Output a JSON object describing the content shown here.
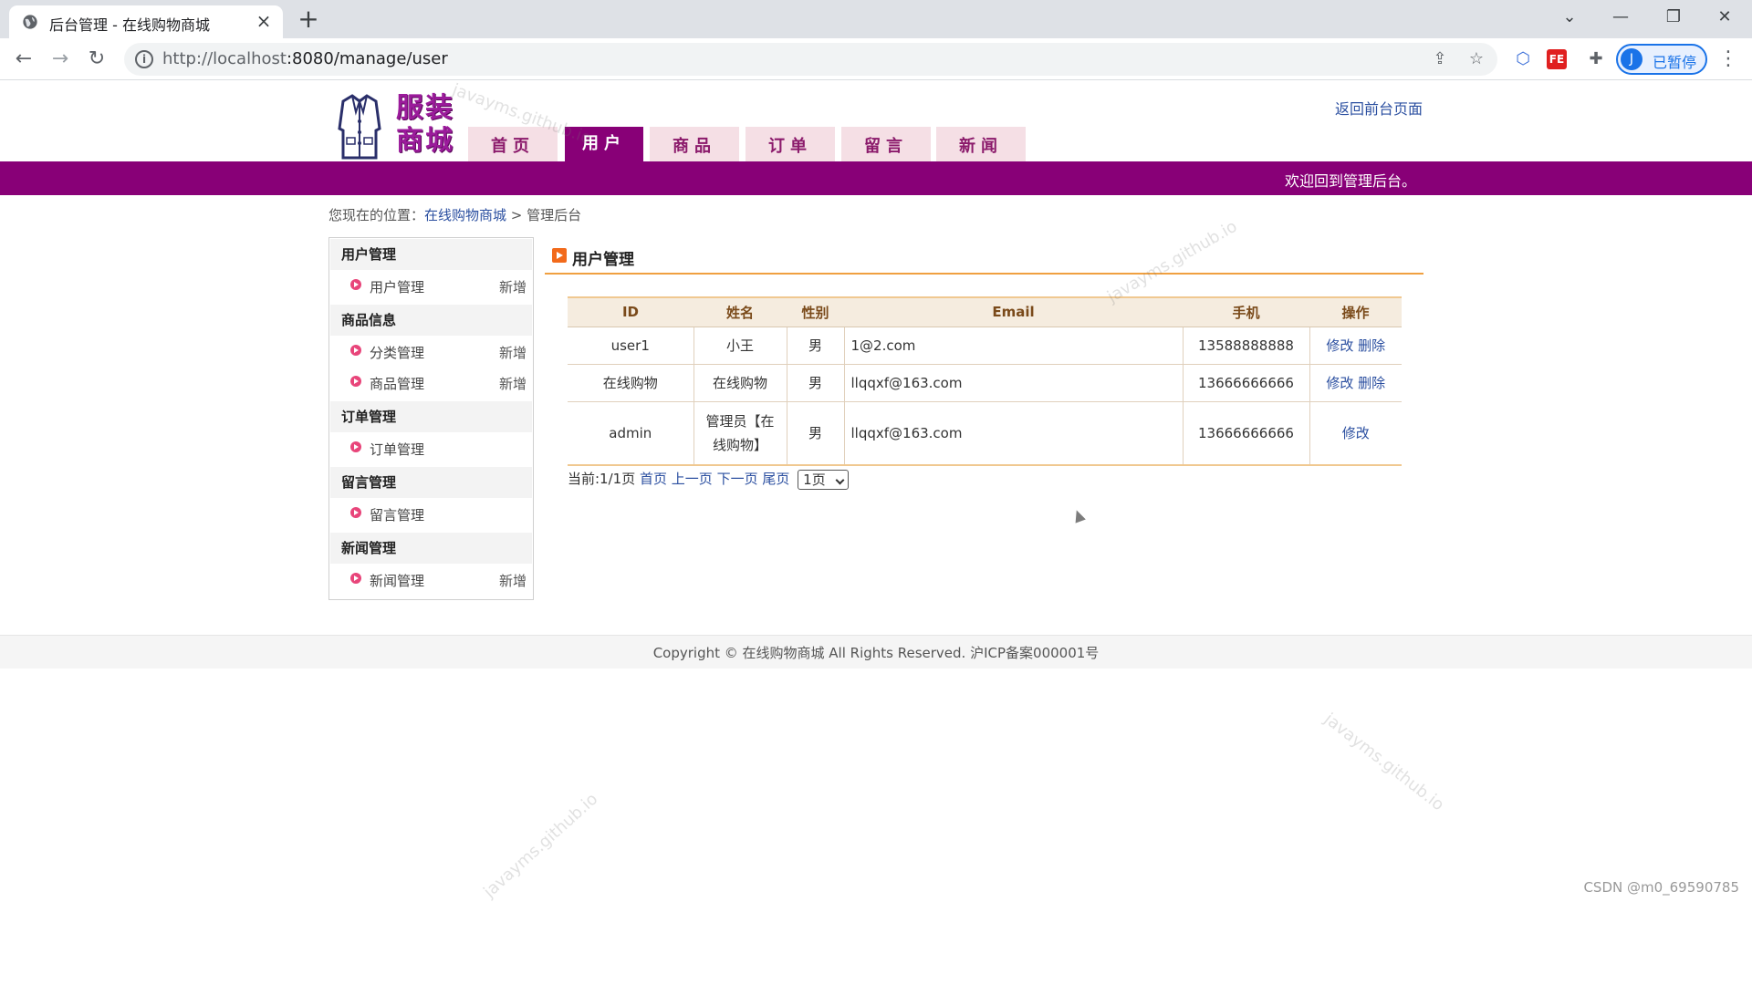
{
  "browser": {
    "tab_title": "后台管理 - 在线购物商城",
    "url_host": "http://localhost",
    "url_path": ":8080/manage/user",
    "profile_initial": "J",
    "profile_label": "已暂停"
  },
  "header": {
    "logo_text_line1": "服装",
    "logo_text_line2": "商城",
    "nav": [
      {
        "label": "首页"
      },
      {
        "label": "用户"
      },
      {
        "label": "商品"
      },
      {
        "label": "订单"
      },
      {
        "label": "留言"
      },
      {
        "label": "新闻"
      }
    ],
    "active_nav": "用户",
    "back_link": "返回前台页面",
    "welcome": "欢迎回到管理后台。"
  },
  "breadcrumb": {
    "prefix": "您现在的位置：",
    "home": "在线购物商城",
    "sep": " > ",
    "current": "管理后台"
  },
  "sidebar": {
    "groups": [
      {
        "title": "用户管理",
        "items": [
          {
            "label": "用户管理",
            "add": "新增"
          }
        ]
      },
      {
        "title": "商品信息",
        "items": [
          {
            "label": "分类管理",
            "add": "新增"
          },
          {
            "label": "商品管理",
            "add": "新增"
          }
        ]
      },
      {
        "title": "订单管理",
        "items": [
          {
            "label": "订单管理",
            "add": ""
          }
        ]
      },
      {
        "title": "留言管理",
        "items": [
          {
            "label": "留言管理",
            "add": ""
          }
        ]
      },
      {
        "title": "新闻管理",
        "items": [
          {
            "label": "新闻管理",
            "add": "新增"
          }
        ]
      }
    ]
  },
  "panel": {
    "title": "用户管理"
  },
  "table": {
    "headers": [
      "ID",
      "姓名",
      "性别",
      "Email",
      "手机",
      "操作"
    ],
    "rows": [
      {
        "id": "user1",
        "name": "小王",
        "gender": "男",
        "email": "1@2.com",
        "phone": "13588888888",
        "edit": "修改",
        "delete": "删除"
      },
      {
        "id": "在线购物",
        "name": "在线购物",
        "gender": "男",
        "email": "llqqxf@163.com",
        "phone": "13666666666",
        "edit": "修改",
        "delete": "删除"
      },
      {
        "id": "admin",
        "name_line1": "管理员【在",
        "name_line2": "线购物】",
        "gender": "男",
        "email": "llqqxf@163.com",
        "phone": "13666666666",
        "edit": "修改"
      }
    ]
  },
  "pager": {
    "status": "当前:1/1页",
    "first": "首页",
    "prev": "上一页",
    "next": "下一页",
    "last": "尾页",
    "selected_page": "1页"
  },
  "footer": {
    "copyright": "Copyright © 在线购物商城 All Rights Reserved. 沪ICP备案000001号"
  },
  "watermark_text": "javayms.github.io",
  "csdn_mark": "CSDN @m0_69590785"
}
